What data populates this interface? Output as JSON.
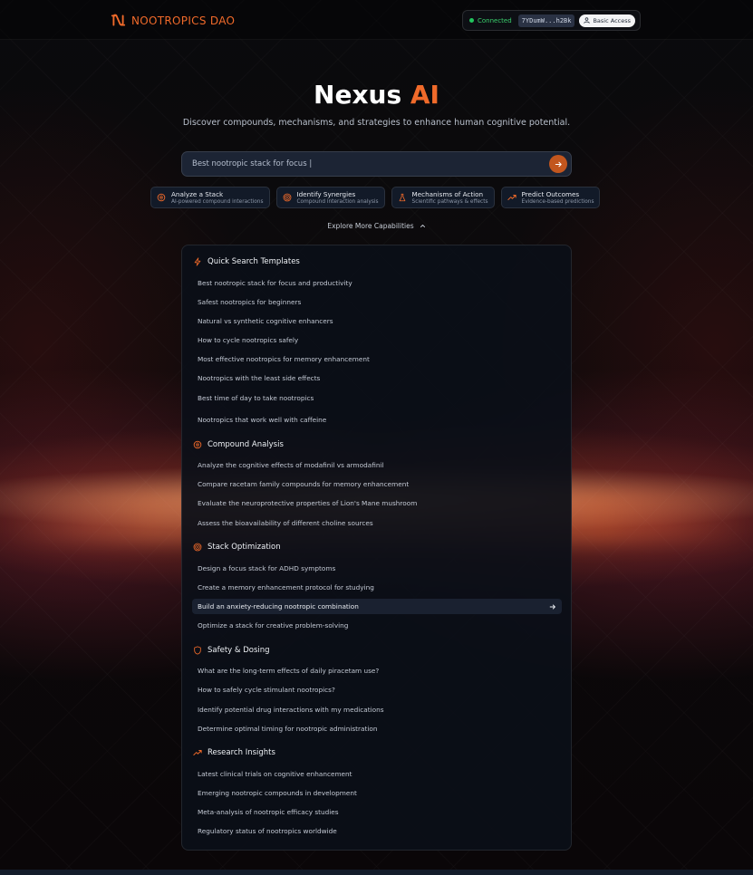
{
  "header": {
    "brand_name": "NOOTROPICS DAO",
    "status_label": "Connected",
    "wallet_address": "7YDumW...h2Bk",
    "access_label": "Basic Access"
  },
  "hero": {
    "title_main": "Nexus",
    "title_accent": "AI",
    "subtitle": "Discover compounds, mechanisms, and strategies to enhance human cognitive potential."
  },
  "search": {
    "value": "Best nootropic stack for focus |"
  },
  "capabilities": [
    {
      "title": "Analyze a Stack",
      "desc": "AI-powered compound interactions",
      "icon": "brain-icon"
    },
    {
      "title": "Identify Synergies",
      "desc": "Compound interaction analysis",
      "icon": "target-icon"
    },
    {
      "title": "Mechanisms of Action",
      "desc": "Scientific pathways & effects",
      "icon": "flask-icon"
    },
    {
      "title": "Predict Outcomes",
      "desc": "Evidence-based predictions",
      "icon": "trend-up-icon"
    }
  ],
  "explore_label": "Explore More Capabilities",
  "sections": [
    {
      "title": "Quick Search Templates",
      "icon": "lightning-icon",
      "items": [
        "Best nootropic stack for focus and productivity",
        "Safest nootropics for beginners",
        "Natural vs synthetic cognitive enhancers",
        "How to cycle nootropics safely",
        "Most effective nootropics for memory enhancement",
        "Nootropics with the least side effects",
        "Best time of day to take nootropics",
        "Nootropics that work well with caffeine"
      ]
    },
    {
      "title": "Compound Analysis",
      "icon": "brain-icon",
      "items": [
        "Analyze the cognitive effects of modafinil vs armodafinil",
        "Compare racetam family compounds for memory enhancement",
        "Evaluate the neuroprotective properties of Lion's Mane mushroom",
        "Assess the bioavailability of different choline sources"
      ]
    },
    {
      "title": "Stack Optimization",
      "icon": "target-icon",
      "items": [
        "Design a focus stack for ADHD symptoms",
        "Create a memory enhancement protocol for studying",
        "Build an anxiety-reducing nootropic combination",
        "Optimize a stack for creative problem-solving"
      ]
    },
    {
      "title": "Safety & Dosing",
      "icon": "shield-icon",
      "items": [
        "What are the long-term effects of daily piracetam use?",
        "How to safely cycle stimulant nootropics?",
        "Identify potential drug interactions with my medications",
        "Determine optimal timing for nootropic administration"
      ]
    },
    {
      "title": "Research Insights",
      "icon": "trend-up-icon",
      "items": [
        "Latest clinical trials on cognitive enhancement",
        "Emerging nootropic compounds in development",
        "Meta-analysis of nootropic efficacy studies",
        "Regulatory status of nootropics worldwide"
      ]
    }
  ],
  "colors": {
    "accent": "#f06a2a",
    "status_green": "#22c55e",
    "panel_bg": "#0b0f18"
  }
}
